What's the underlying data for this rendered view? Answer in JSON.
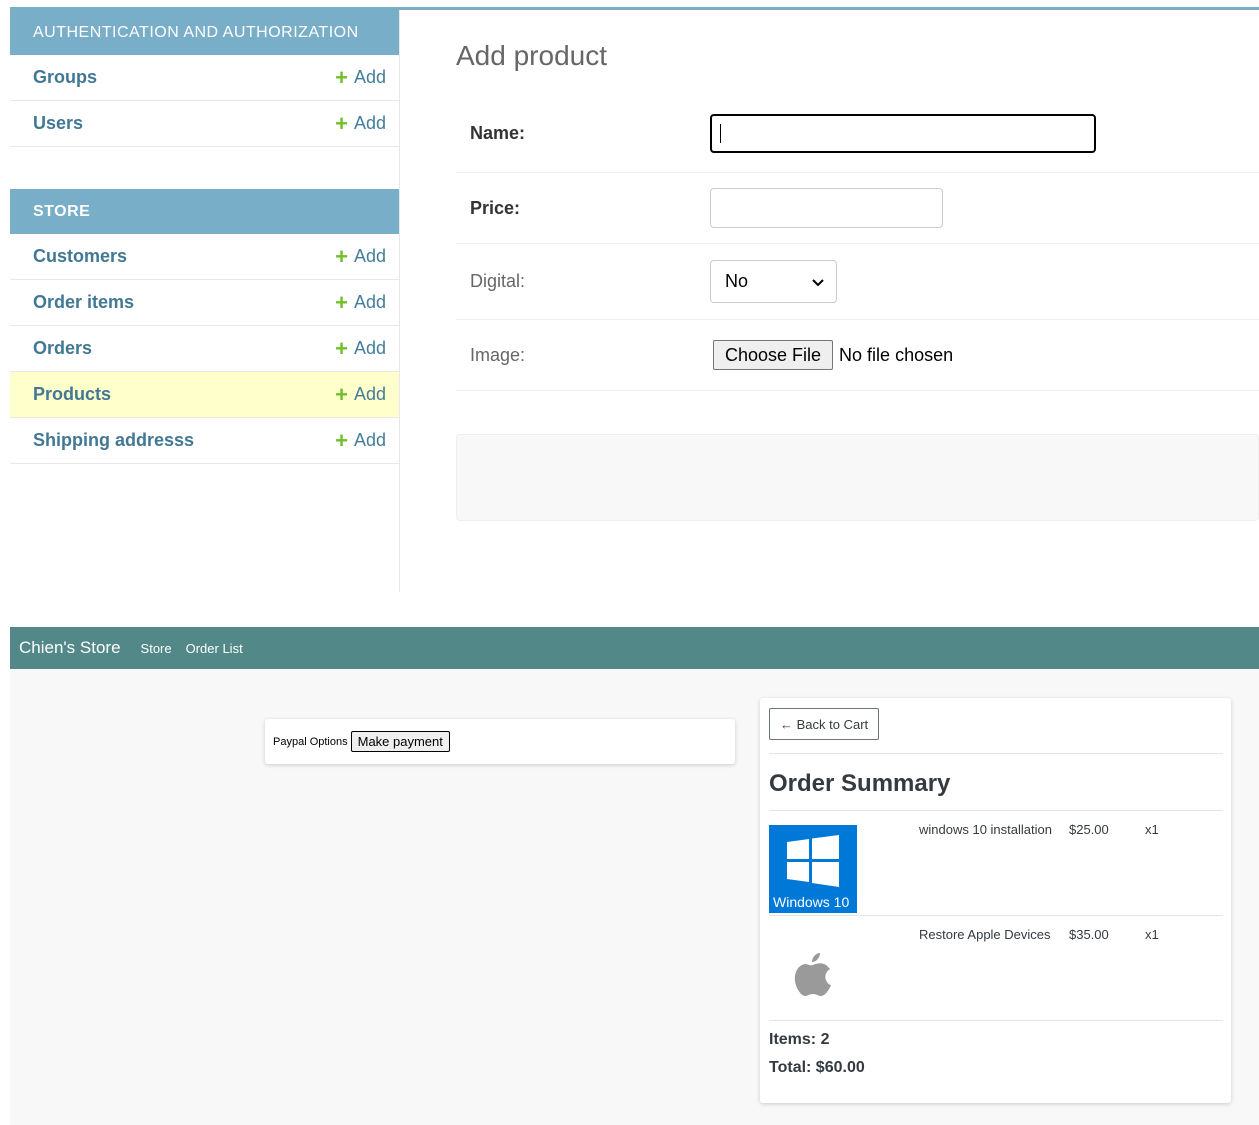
{
  "admin": {
    "sidebar": {
      "auth_module": {
        "caption": "AUTHENTICATION AND AUTHORIZATION",
        "items": [
          {
            "label": "Groups",
            "add": "Add"
          },
          {
            "label": "Users",
            "add": "Add"
          }
        ]
      },
      "store_module": {
        "caption": "STORE",
        "items": [
          {
            "label": "Customers",
            "add": "Add"
          },
          {
            "label": "Order items",
            "add": "Add"
          },
          {
            "label": "Orders",
            "add": "Add"
          },
          {
            "label": "Products",
            "add": "Add",
            "selected": true
          },
          {
            "label": "Shipping addresss",
            "add": "Add"
          }
        ]
      }
    },
    "form": {
      "title": "Add product",
      "name_label": "Name:",
      "name_value": "",
      "price_label": "Price:",
      "price_value": "",
      "digital_label": "Digital:",
      "digital_selected": "No",
      "image_label": "Image:",
      "choose_file": "Choose File",
      "no_file": "No file chosen"
    },
    "accent_color": "#79aec8",
    "link_color": "#417893",
    "add_icon_color": "#70bf2b"
  },
  "store": {
    "navbar": {
      "brand": "Chien's Store",
      "links": [
        "Store",
        "Order List"
      ],
      "color": "#528888"
    },
    "payment": {
      "label": "Paypal Options",
      "button": "Make payment"
    },
    "summary": {
      "back_button": "← Back to Cart",
      "title": "Order Summary",
      "items": [
        {
          "name": "windows 10 installation",
          "price": "$25.00",
          "qty": "x1",
          "image_caption": "Windows 10",
          "icon": "windows-logo-icon"
        },
        {
          "name": "Restore Apple Devices",
          "price": "$35.00",
          "qty": "x1",
          "icon": "apple-logo-icon"
        }
      ],
      "items_count": "Items: 2",
      "total": "Total: $60.00"
    }
  }
}
